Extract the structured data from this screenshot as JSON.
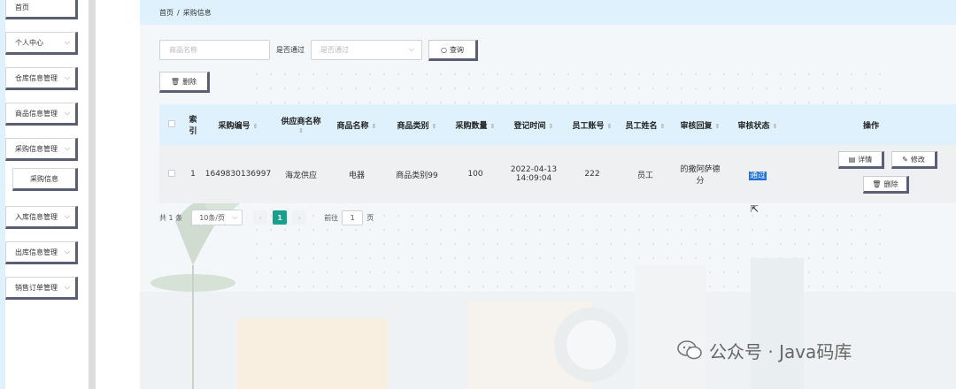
{
  "sidebar": {
    "items": [
      {
        "label": "首页",
        "chevron": false
      },
      {
        "label": "个人中心",
        "chevron": true
      },
      {
        "label": "仓库信息管理",
        "chevron": true
      },
      {
        "label": "商品信息管理",
        "chevron": true
      },
      {
        "label": "采购信息管理",
        "chevron": true
      },
      {
        "label": "采购信息",
        "chevron": false,
        "sub": true
      },
      {
        "label": "入库信息管理",
        "chevron": true
      },
      {
        "label": "出库信息管理",
        "chevron": true
      },
      {
        "label": "销售订单管理",
        "chevron": true
      }
    ]
  },
  "breadcrumb": {
    "home": "首页",
    "separator": "/",
    "current": "采购信息"
  },
  "search": {
    "name_placeholder": "商品名称",
    "approved_label": "是否通过",
    "approved_placeholder": "是否通过",
    "query_label": "查询"
  },
  "toolbar": {
    "delete_label": "删除"
  },
  "table": {
    "columns": [
      {
        "label": "",
        "sortable": false
      },
      {
        "label": "索引",
        "sortable": false
      },
      {
        "label": "采购编号",
        "sortable": true
      },
      {
        "label": "供应商名称",
        "sortable": true
      },
      {
        "label": "商品名称",
        "sortable": true
      },
      {
        "label": "商品类别",
        "sortable": true
      },
      {
        "label": "采购数量",
        "sortable": true
      },
      {
        "label": "登记时间",
        "sortable": true
      },
      {
        "label": "员工账号",
        "sortable": true
      },
      {
        "label": "员工姓名",
        "sortable": true
      },
      {
        "label": "审核回复",
        "sortable": true
      },
      {
        "label": "审核状态",
        "sortable": true
      },
      {
        "label": "操作",
        "sortable": false
      }
    ],
    "rows": [
      {
        "index": "1",
        "purchase_no": "1649830136997",
        "supplier": "海龙供应",
        "product": "电器",
        "category": "商品类别99",
        "quantity": "100",
        "reg_date": "2022-04-13",
        "reg_time": "14:09:04",
        "emp_account": "222",
        "emp_name": "员工",
        "reply": "的撒阿萨德分",
        "status": "通过"
      }
    ],
    "ops": {
      "detail": "详情",
      "edit": "修改",
      "delete": "删除"
    }
  },
  "pagination": {
    "total": "共 1 条",
    "page_size": "10条/页",
    "prev": "‹",
    "current_page": "1",
    "next": "›",
    "goto": "前往",
    "goto_value": "1",
    "unit": "页"
  },
  "watermark": {
    "text": "公众号 · Java码库"
  },
  "colors": {
    "accent": "#17a08b",
    "header_bg": "#dff1fc",
    "selection": "#1e6fd9",
    "btn_shadow": "#5a5f75"
  }
}
